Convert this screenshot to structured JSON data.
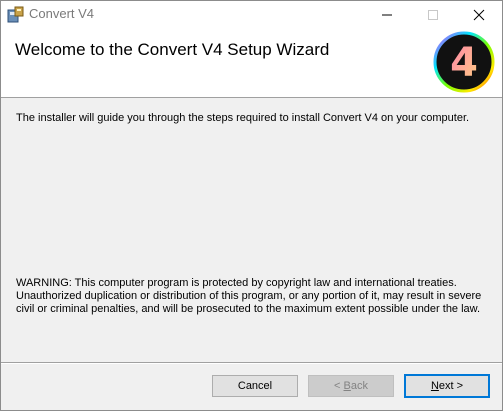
{
  "window": {
    "title": "Convert V4",
    "icon": "installer-icon",
    "controls": [
      "minimize-icon",
      "maximize-icon",
      "close-icon"
    ]
  },
  "banner": {
    "heading": "Welcome to the Convert V4 Setup Wizard",
    "logo_text": "4"
  },
  "body": {
    "intro": "The installer will guide you through the steps required to install Convert V4 on your computer.",
    "warning": "WARNING: This computer program is protected by copyright law and international treaties. Unauthorized duplication or distribution of this program, or any portion of it, may result in severe civil or criminal penalties, and will be prosecuted to the maximum extent possible under the law."
  },
  "buttons": {
    "cancel": "Cancel",
    "back_mnemonic": "B",
    "back_rest": "ack",
    "back_prefix": "< ",
    "next_mnemonic": "N",
    "next_rest": "ext >"
  },
  "colors": {
    "focus_border": "#0078d7",
    "logo_ring": [
      "#e040fb",
      "#00e5ff",
      "#76ff03",
      "#ffea00",
      "#ff3d00"
    ]
  }
}
